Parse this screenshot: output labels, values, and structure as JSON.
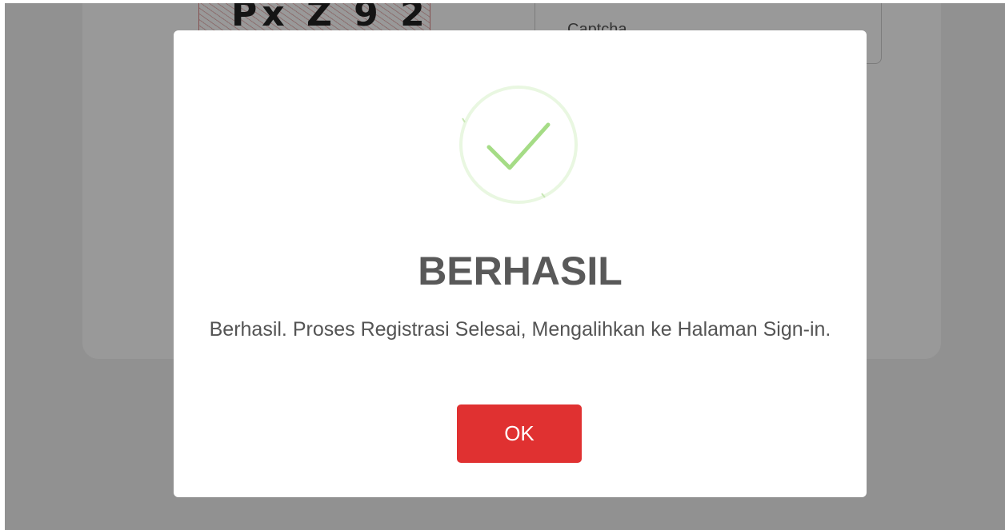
{
  "background": {
    "captcha_text": "Px Z 9 2",
    "captcha_placeholder": "Captcha"
  },
  "dialog": {
    "icon": "checkmark-success-icon",
    "title": "BERHASIL",
    "message": "Berhasil. Proses Registrasi Selesai, Mengalihkan ke Halaman Sign-in.",
    "ok_label": "OK"
  },
  "colors": {
    "success": "#a5dc86",
    "success_ring": "#e9f7e1",
    "button": "#e03131",
    "title": "#595959"
  }
}
